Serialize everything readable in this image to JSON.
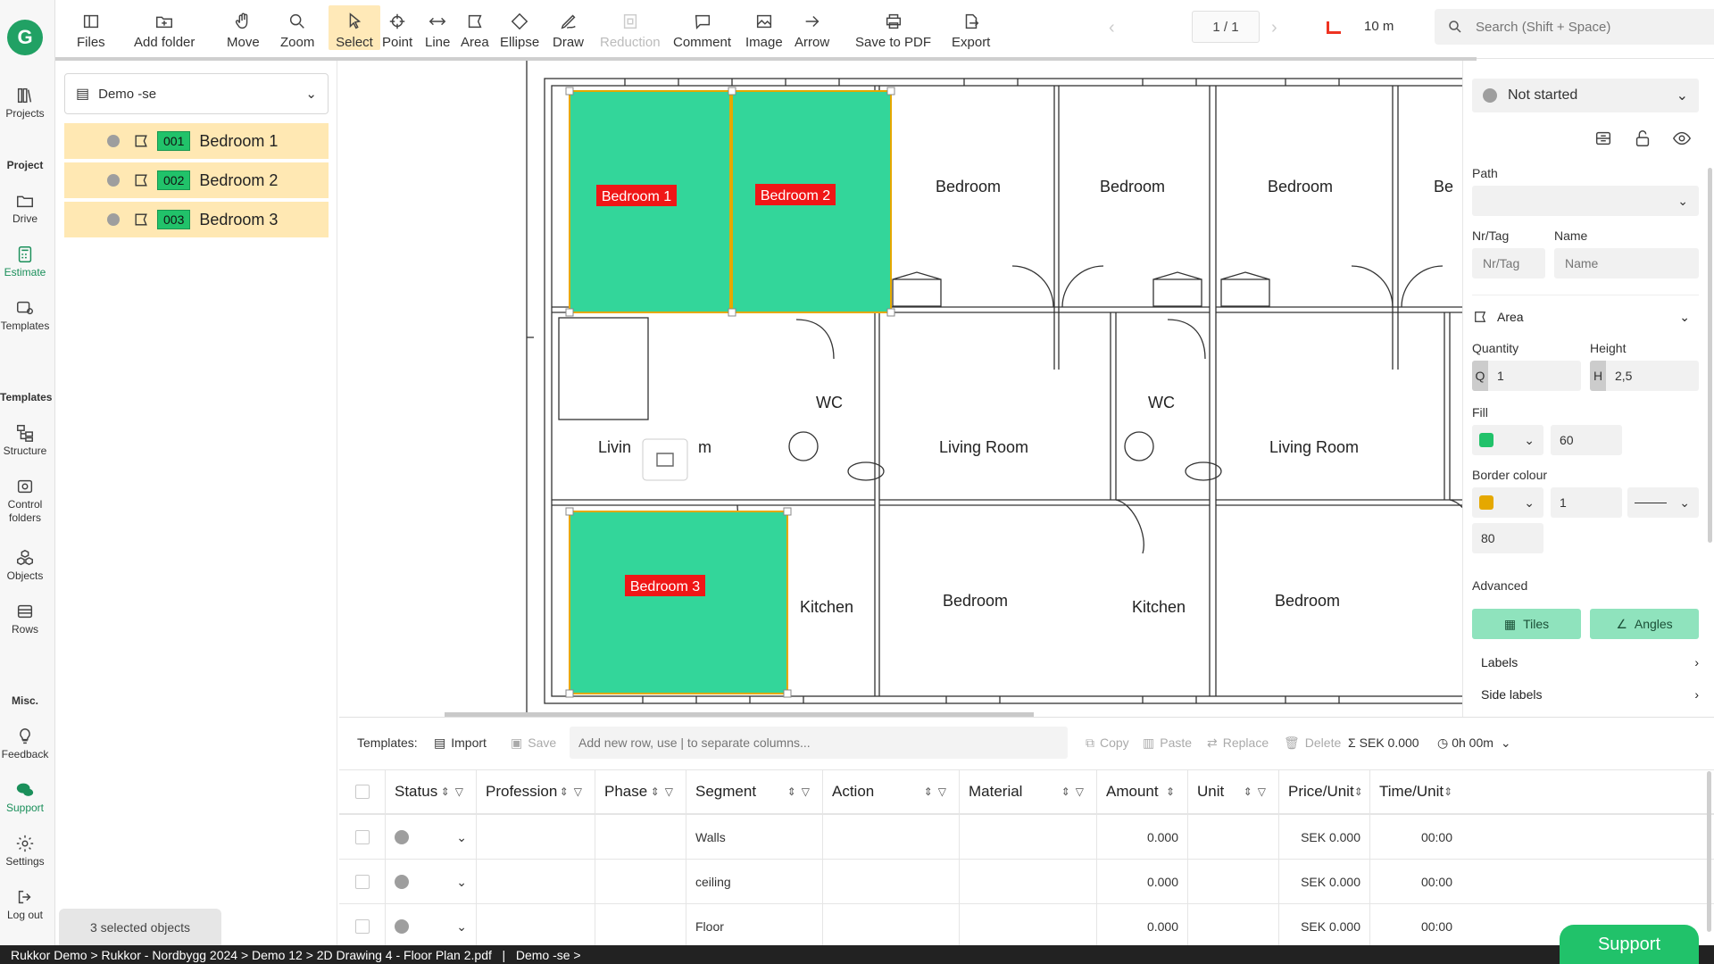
{
  "app": {
    "logo_letter": "G"
  },
  "rail": {
    "items": [
      {
        "label": "Projects"
      },
      {
        "label": "Drive"
      },
      {
        "label": "Estimate"
      },
      {
        "label": "Templates"
      },
      {
        "label": "Structure"
      },
      {
        "label": "Control folders"
      },
      {
        "label": "Objects"
      },
      {
        "label": "Rows"
      },
      {
        "label": "Feedback"
      },
      {
        "label": "Support"
      },
      {
        "label": "Settings"
      },
      {
        "label": "Log out"
      }
    ],
    "sections": {
      "project": "Project",
      "templates": "Templates",
      "misc": "Misc."
    }
  },
  "toolbar": {
    "tools": [
      "Files",
      "Add folder",
      "Move",
      "Zoom",
      "Select",
      "Point",
      "Line",
      "Area",
      "Ellipse",
      "Draw",
      "Reduction",
      "Comment",
      "Image",
      "Arrow",
      "Save to PDF",
      "Export"
    ],
    "page": "1 / 1",
    "scale": "10 m",
    "search_placeholder": "Search (Shift + Space)"
  },
  "leftpanel": {
    "project_select": "Demo -se",
    "objects": [
      {
        "nr": "001",
        "name": "Bedroom 1"
      },
      {
        "nr": "002",
        "name": "Bedroom 2"
      },
      {
        "nr": "003",
        "name": "Bedroom 3"
      }
    ],
    "selected_badge": "3 selected objects"
  },
  "plan": {
    "labels": {
      "bedroom": "Bedroom",
      "living_room": "Living Room",
      "living_room_partial_left": "Livin",
      "living_room_partial_right": "m",
      "wc": "WC",
      "kitchen": "Kitchen",
      "bedroom_partial": "Be"
    },
    "area_tags": [
      "Bedroom 1",
      "Bedroom 2",
      "Bedroom 3"
    ],
    "colors": {
      "area_fill": "#33d69a",
      "area_border": "#e5a800",
      "tag_bg": "#f01616"
    }
  },
  "rightpanel": {
    "status": "Not started",
    "path_label": "Path",
    "nrtag_label": "Nr/Tag",
    "name_label": "Name",
    "nrtag_placeholder": "Nr/Tag",
    "name_placeholder": "Name",
    "type": "Area",
    "quantity_label": "Quantity",
    "height_label": "Height",
    "q_prefix": "Q",
    "h_prefix": "H",
    "quantity": "1",
    "height": "2,5",
    "fill_label": "Fill",
    "fill_opacity": "60",
    "border_label": "Border colour",
    "border_width": "1",
    "border_opacity": "80",
    "advanced_label": "Advanced",
    "tiles_btn": "Tiles",
    "angles_btn": "Angles",
    "labels_row": "Labels",
    "side_labels_row": "Side labels",
    "colors": {
      "fill": "#21c26a",
      "border": "#e5a800"
    }
  },
  "bottom": {
    "templates_label": "Templates:",
    "import": "Import",
    "save": "Save",
    "row_placeholder": "Add new row, use | to separate columns...",
    "copy": "Copy",
    "paste": "Paste",
    "replace": "Replace",
    "delete": "Delete",
    "total": "SEK 0.000",
    "time": "0h 00m",
    "columns": [
      "Status",
      "Profession",
      "Phase",
      "Segment",
      "Action",
      "Material",
      "Amount",
      "Unit",
      "Price/Unit",
      "Time/Unit"
    ],
    "rows": [
      {
        "segment": "Walls",
        "amount": "0.000",
        "price": "SEK 0.000",
        "time": "00:00"
      },
      {
        "segment": "ceiling",
        "amount": "0.000",
        "price": "SEK 0.000",
        "time": "00:00"
      },
      {
        "segment": "Floor",
        "amount": "0.000",
        "price": "SEK 0.000",
        "time": "00:00"
      }
    ]
  },
  "statusbar": {
    "breadcrumb": "Rukkor Demo > Rukkor - Nordbygg 2024 > Demo 12 > 2D Drawing 4 - Floor Plan 2.pdf   |   Demo -se >"
  },
  "support_button": "Support"
}
